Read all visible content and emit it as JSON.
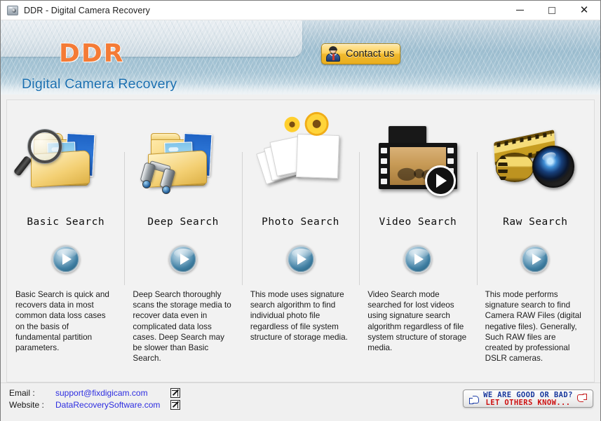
{
  "window": {
    "title": "DDR - Digital Camera Recovery",
    "app_icon": "camera-icon",
    "controls": {
      "minimize": "minimize",
      "maximize": "maximize",
      "close": "close"
    }
  },
  "header": {
    "logo": "DDR",
    "subtitle": "Digital Camera Recovery",
    "contact_button": "Contact us",
    "accent_orange": "#f47b36",
    "subtitle_blue": "#1a6fb0"
  },
  "modes": [
    {
      "label": "Basic Search",
      "icon": "folder-magnifier-icon",
      "description": "Basic Search is quick and recovers data in most common data loss cases on the basis of fundamental partition parameters."
    },
    {
      "label": "Deep Search",
      "icon": "folder-binoculars-icon",
      "description": "Deep Search thoroughly scans the storage media to recover data even in complicated data loss cases. Deep Search may be slower than Basic Search."
    },
    {
      "label": "Photo Search",
      "icon": "photo-stack-icon",
      "description": "This mode uses signature search algorithm to find individual photo file regardless of file system structure of storage media."
    },
    {
      "label": "Video Search",
      "icon": "film-strip-play-icon",
      "description": "Video Search mode searched for lost videos using signature search algorithm regardless of file system structure of storage media."
    },
    {
      "label": "Raw Search",
      "icon": "film-roll-lens-icon",
      "description": "This mode performs signature search to find Camera RAW Files (digital negative files). Generally, Such RAW files are created by professional DSLR cameras."
    }
  ],
  "play_button_icon": "play-icon",
  "footer": {
    "email_label": "Email :",
    "email_value": "support@fixdigicam.com",
    "website_label": "Website :",
    "website_value": "DataRecoverySoftware.com",
    "external_link_icon": "external-link-icon",
    "link_color": "#2d2de0",
    "feedback": {
      "line1": "WE ARE GOOD OR BAD?",
      "line2": "LET OTHERS KNOW...",
      "thumbs_up_icon": "thumbs-up-icon",
      "thumbs_down_icon": "thumbs-down-icon",
      "line1_color": "#17379c",
      "line2_color": "#cc1111"
    }
  }
}
